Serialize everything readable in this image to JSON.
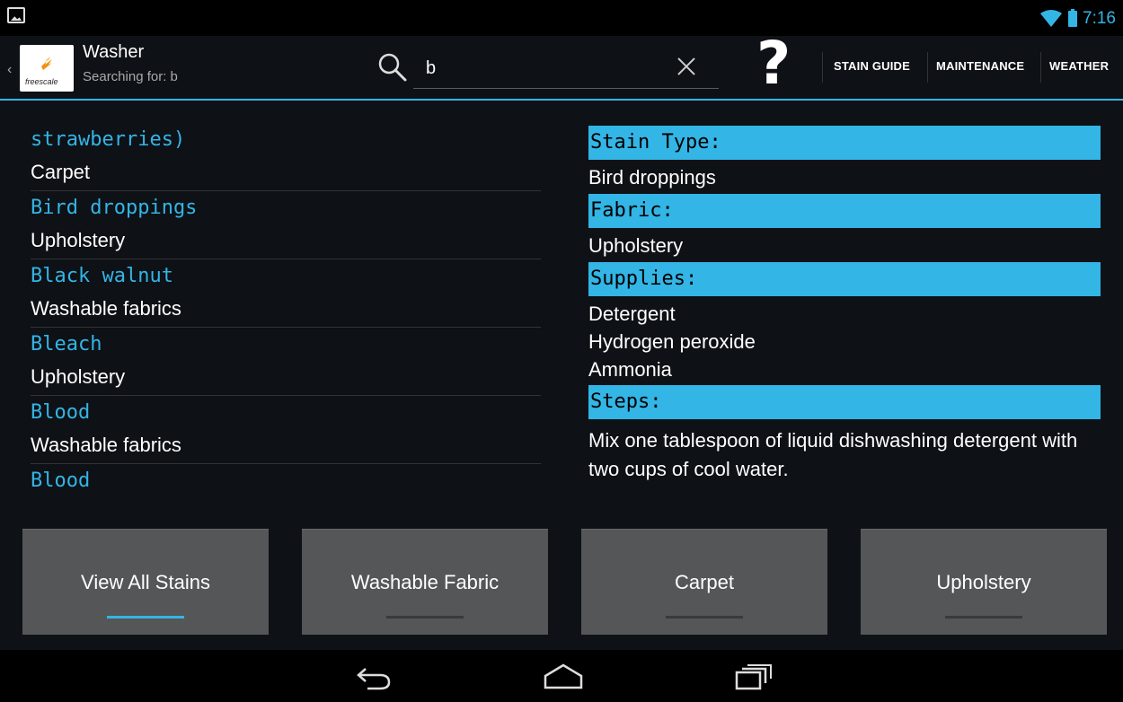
{
  "status_bar": {
    "time": "7:16",
    "left_icon": "picture-icon",
    "icons": [
      "wifi-icon",
      "battery-icon"
    ],
    "accent_color": "#33b5e5"
  },
  "action_bar": {
    "up_icon": "back-caret-icon",
    "logo_text": "freescale",
    "title": "Washer",
    "subtitle": "Searching for: b",
    "search_icon": "search-icon",
    "search_value": "b",
    "clear_icon": "close-icon",
    "help_icon": "?",
    "menu": [
      "STAIN GUIDE",
      "MAINTENANCE",
      "WEATHER"
    ]
  },
  "stain_list": [
    {
      "stain": "strawberries)",
      "fabric": "Carpet"
    },
    {
      "stain": "Bird droppings",
      "fabric": "Upholstery"
    },
    {
      "stain": "Black walnut",
      "fabric": "Washable fabrics"
    },
    {
      "stain": "Bleach",
      "fabric": "Upholstery"
    },
    {
      "stain": "Blood",
      "fabric": "Washable fabrics"
    },
    {
      "stain": "Blood",
      "fabric": ""
    }
  ],
  "detail": {
    "stain_type_label": "Stain Type:",
    "stain_type": "Bird droppings",
    "fabric_label": "Fabric:",
    "fabric": "Upholstery",
    "supplies_label": "Supplies:",
    "supplies": [
      "Detergent",
      "Hydrogen peroxide",
      "Ammonia"
    ],
    "steps_label": "Steps:",
    "steps": "Mix one tablespoon of liquid dishwashing detergent with two cups of cool water."
  },
  "filter_buttons": [
    {
      "label": "View All Stains",
      "active": true
    },
    {
      "label": "Washable Fabric",
      "active": false
    },
    {
      "label": "Carpet",
      "active": false
    },
    {
      "label": "Upholstery",
      "active": false
    }
  ],
  "nav_bar": {
    "icons": [
      "back-icon",
      "home-icon",
      "recent-apps-icon"
    ]
  }
}
